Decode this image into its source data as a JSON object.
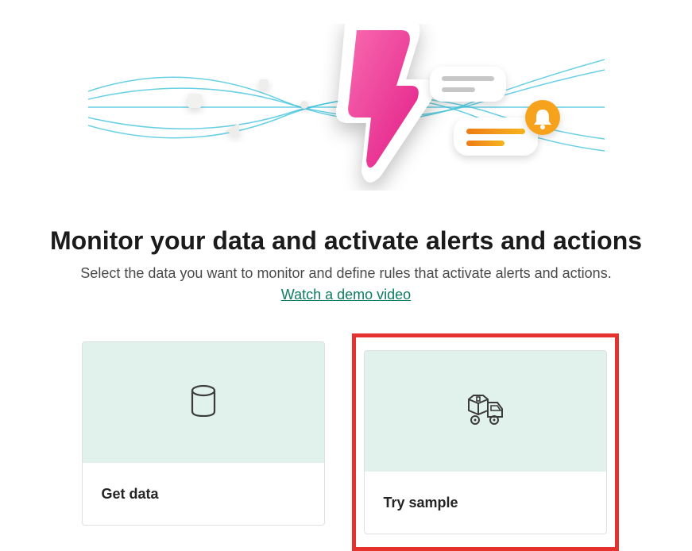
{
  "hero": {
    "title": "Monitor your data and activate alerts and actions",
    "subtitle": "Select the data you want to monitor and define rules that activate alerts and actions.",
    "video_link": "Watch a demo video"
  },
  "cards": {
    "get_data": {
      "label": "Get data"
    },
    "try_sample": {
      "label": "Try sample"
    }
  },
  "illustration": {
    "bolt_color_start": "#f24a9b",
    "bolt_color_end": "#d9187b",
    "bell_bg": "#f5a623",
    "line_color": "#33b8d6"
  }
}
